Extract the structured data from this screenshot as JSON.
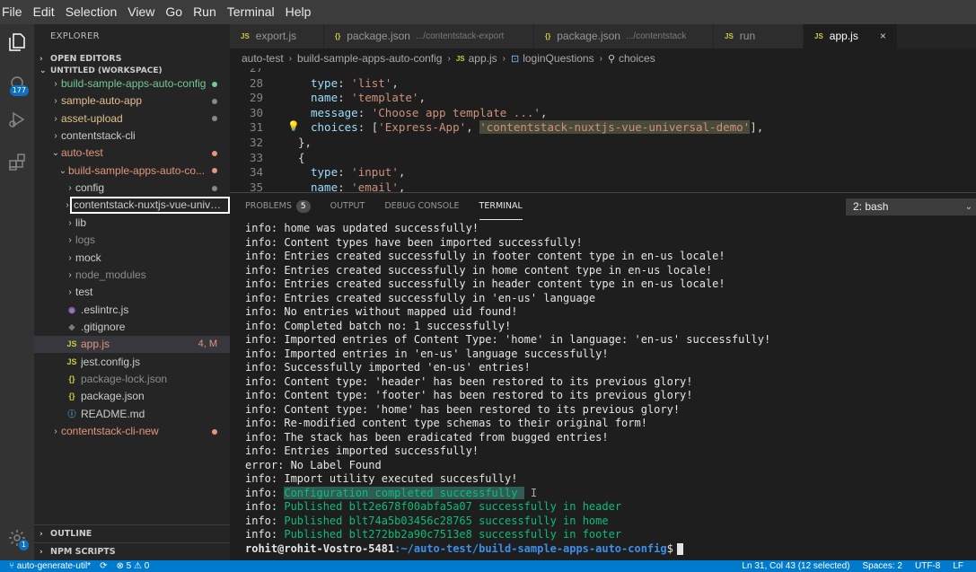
{
  "menu": [
    "File",
    "Edit",
    "Selection",
    "View",
    "Go",
    "Run",
    "Terminal",
    "Help"
  ],
  "activity": {
    "explorer_icon": "files-icon",
    "scm_badge": "177",
    "settings_badge": "1"
  },
  "sidebar": {
    "title": "EXPLORER",
    "open_editors": "OPEN EDITORS",
    "workspace": "UNTITLED (WORKSPACE)",
    "outline": "OUTLINE",
    "npm_scripts": "NPM SCRIPTS",
    "items": [
      {
        "label": "build-sample-apps-auto-config",
        "type": "folder",
        "twisty": "›",
        "color": "green",
        "dot": "#73c991"
      },
      {
        "label": "sample-auto-app",
        "type": "folder",
        "twisty": "›",
        "color": "amber",
        "dot": "#888888"
      },
      {
        "label": "asset-upload",
        "type": "folder",
        "twisty": "›",
        "color": "amber",
        "dot": "#888888"
      },
      {
        "label": "contentstack-cli",
        "type": "folder",
        "twisty": "›",
        "color": "normal"
      },
      {
        "label": "auto-test",
        "type": "folder",
        "twisty": "⌄",
        "color": "mod",
        "dot": "#e2967a"
      },
      {
        "label": "build-sample-apps-auto-co...",
        "type": "folder",
        "twisty": "⌄",
        "color": "mod",
        "dot": "#e2967a"
      },
      {
        "label": "config",
        "type": "folder",
        "twisty": "›",
        "color": "normal",
        "dot": "#888888"
      },
      {
        "label": "contentstack-nuxtjs-vue-univer...",
        "type": "folder",
        "twisty": "›",
        "color": "normal",
        "boxed": true
      },
      {
        "label": "lib",
        "type": "folder",
        "twisty": "›",
        "color": "normal"
      },
      {
        "label": "logs",
        "type": "folder",
        "twisty": "›",
        "color": "gray"
      },
      {
        "label": "mock",
        "type": "folder",
        "twisty": "›",
        "color": "normal"
      },
      {
        "label": "node_modules",
        "type": "folder",
        "twisty": "›",
        "color": "gray"
      },
      {
        "label": "test",
        "type": "folder",
        "twisty": "›",
        "color": "normal"
      },
      {
        "label": ".eslintrc.js",
        "type": "file",
        "icon": "◉",
        "icon_color": "#a074c4",
        "color": "normal"
      },
      {
        "label": ".gitignore",
        "type": "file",
        "icon": "◆",
        "icon_color": "#6d8086",
        "color": "normal"
      },
      {
        "label": "app.js",
        "type": "file",
        "icon": "JS",
        "icon_color": "#cbcb41",
        "color": "mod",
        "status": "4, M",
        "selected": true
      },
      {
        "label": "jest.config.js",
        "type": "file",
        "icon": "JS",
        "icon_color": "#cbcb41",
        "color": "normal"
      },
      {
        "label": "package-lock.json",
        "type": "file",
        "icon": "{}",
        "icon_color": "#cbcb41",
        "color": "gray"
      },
      {
        "label": "package.json",
        "type": "file",
        "icon": "{}",
        "icon_color": "#cbcb41",
        "color": "normal"
      },
      {
        "label": "README.md",
        "type": "file",
        "icon": "ⓘ",
        "icon_color": "#519aba",
        "color": "normal"
      },
      {
        "label": "contentstack-cli-new",
        "type": "folder",
        "twisty": "›",
        "color": "mod",
        "dot": "#e2967a"
      }
    ]
  },
  "tabs": [
    {
      "icon": "JS",
      "label": "export.js",
      "desc": ""
    },
    {
      "icon": "{}",
      "label": "package.json",
      "desc": ".../contentstack-export"
    },
    {
      "icon": "{}",
      "label": "package.json",
      "desc": ".../contentstack"
    },
    {
      "icon": "JS",
      "label": "run",
      "desc": ""
    },
    {
      "icon": "JS",
      "label": "app.js",
      "desc": "",
      "active": true,
      "close": "×"
    }
  ],
  "breadcrumb": [
    "auto-test",
    "build-sample-apps-auto-config",
    "app.js",
    "loginQuestions",
    "choices"
  ],
  "editor": {
    "lines": [
      {
        "n": "27",
        "text": ""
      },
      {
        "n": "28",
        "key": "type",
        "value": "'list'"
      },
      {
        "n": "29",
        "key": "name",
        "value": "'template'"
      },
      {
        "n": "30",
        "key": "message",
        "value": "'Choose app template ...'"
      },
      {
        "n": "31",
        "key": "choices",
        "value1": "'Express-App'",
        "value2": "'contentstack-nuxtjs-vue-universal-demo'"
      },
      {
        "n": "32",
        "text": "},"
      },
      {
        "n": "33",
        "text": "{"
      },
      {
        "n": "34",
        "key": "type",
        "value": "'input'"
      },
      {
        "n": "35",
        "key": "name",
        "value": "'email'"
      }
    ]
  },
  "panel": {
    "tabs": [
      "PROBLEMS",
      "OUTPUT",
      "DEBUG CONSOLE",
      "TERMINAL"
    ],
    "problems_count": "5",
    "terminal_select": "2: bash",
    "terminal_lines": [
      {
        "text": "info: home was updated successfully!"
      },
      {
        "text": "info: Content types have been imported successfully!"
      },
      {
        "text": "info: Entries created successfully in footer content type in en-us locale!"
      },
      {
        "text": "info: Entries created successfully in home content type in en-us locale!"
      },
      {
        "text": "info: Entries created successfully in header content type in en-us locale!"
      },
      {
        "text": "info: Entries created successfully in 'en-us' language"
      },
      {
        "text": "info: No entries without mapped uid found!"
      },
      {
        "text": "info: Completed batch no: 1 successfully!"
      },
      {
        "text": "info: Imported entries of Content Type: 'home' in language: 'en-us' successfully!"
      },
      {
        "text": "info: Imported entries in 'en-us' language successfully!"
      },
      {
        "text": "info: Successfully imported 'en-us' entries!"
      },
      {
        "text": "info: Content type: 'header' has been restored to its previous glory!"
      },
      {
        "text": "info: Content type: 'footer' has been restored to its previous glory!"
      },
      {
        "text": "info: Content type: 'home' has been restored to its previous glory!"
      },
      {
        "text": "info: Re-modified content type schemas to their original form!"
      },
      {
        "text": "info: The stack has been eradicated from bugged entries!"
      },
      {
        "text": "info: Entries imported successfully!"
      },
      {
        "text": "error: No Label Found"
      },
      {
        "text": "info: Import utility executed succesfully!"
      },
      {
        "prefix": "info: ",
        "highlight": "Configuration completed successfully "
      },
      {
        "prefix": "info: ",
        "green": "Published blt2e678f00abfa5a07 successfully in header"
      },
      {
        "prefix": "info: ",
        "green": "Published blt74a5b03456c28765 successfully in home"
      },
      {
        "prefix": "info: ",
        "green": "Published blt272bb2a90c7513e8 successfully in footer"
      }
    ],
    "prompt_user": "rohit@rohit-Vostro-5481",
    "prompt_path": ":~/auto-test/build-sample-apps-auto-config",
    "prompt_symbol": "$"
  },
  "statusbar": {
    "branch": "auto-generate-util*",
    "sync": "⟳",
    "errors": "⊗ 5 ⚠ 0",
    "position": "Ln 31, Col 43 (12 selected)",
    "spaces": "Spaces: 2",
    "encoding": "UTF-8",
    "eol": "LF"
  }
}
